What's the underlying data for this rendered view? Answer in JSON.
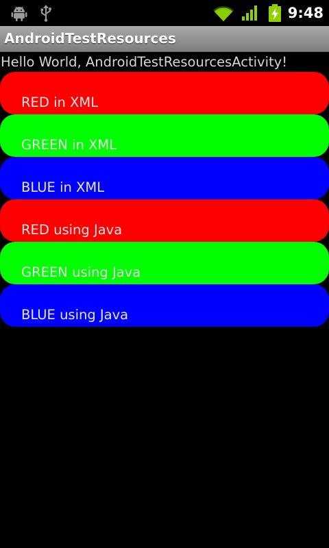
{
  "status_bar": {
    "icons": [
      "android-debug-icon",
      "usb-icon",
      "wifi-icon",
      "signal-icon",
      "battery-charging-icon"
    ],
    "time": "9:48"
  },
  "app": {
    "title": "AndroidTestResources"
  },
  "content": {
    "hello_text": "Hello World, AndroidTestResourcesActivity!",
    "buttons": [
      {
        "label": "RED in XML",
        "color": "#ff0000"
      },
      {
        "label": "GREEN in XML",
        "color": "#00ff00"
      },
      {
        "label": "BLUE in XML",
        "color": "#0000ff"
      },
      {
        "label": "RED using Java",
        "color": "#ff0000"
      },
      {
        "label": "GREEN using Java",
        "color": "#00ff00"
      },
      {
        "label": "BLUE using Java",
        "color": "#0000ff"
      }
    ]
  }
}
